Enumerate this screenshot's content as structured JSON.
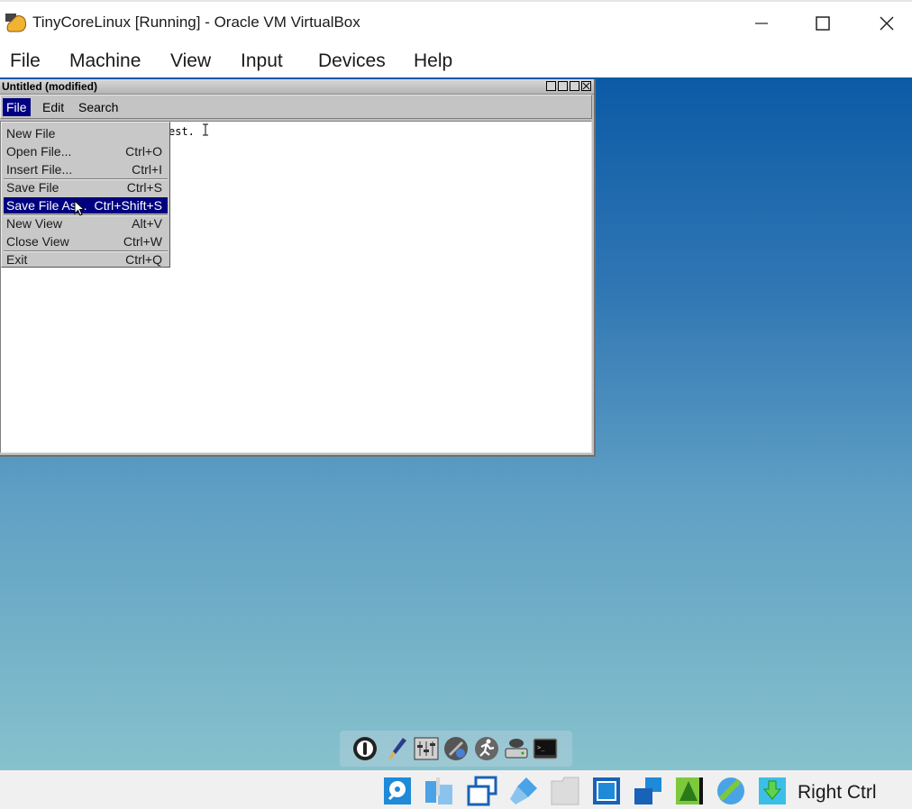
{
  "window": {
    "title": "TinyCoreLinux [Running] - Oracle VM VirtualBox",
    "minimize_glyph": "—",
    "close_glyph": "✕"
  },
  "host_menu": [
    "File",
    "Machine",
    "View",
    "Input",
    "Devices",
    "Help"
  ],
  "editor": {
    "title": "Untitled (modified)",
    "menus": [
      {
        "label": "File",
        "active": true
      },
      {
        "label": "Edit",
        "active": false
      },
      {
        "label": "Search",
        "active": false
      }
    ],
    "visible_text": "est.",
    "file_menu": [
      {
        "label": "New File",
        "shortcut": ""
      },
      {
        "label": "Open File...",
        "shortcut": "Ctrl+O"
      },
      {
        "label": "Insert File...",
        "shortcut": "Ctrl+I"
      },
      {
        "label": "Save File",
        "shortcut": "Ctrl+S"
      },
      {
        "label": "Save File As...",
        "shortcut": "Ctrl+Shift+S",
        "highlighted": true
      },
      {
        "label": "New View",
        "shortcut": "Alt+V"
      },
      {
        "label": "Close View",
        "shortcut": "Ctrl+W"
      },
      {
        "label": "Exit",
        "shortcut": "Ctrl+Q"
      }
    ]
  },
  "dock_icons": [
    "power-icon",
    "paint-brush-icon",
    "control-panel-icon",
    "apps-icon",
    "run-icon",
    "mount-icon",
    "terminal-icon"
  ],
  "status_icons": [
    "hard-disk-icon",
    "optical-drive-icon",
    "shared-windows-icon",
    "usb-icon",
    "shared-folder-icon",
    "display-icon",
    "network-icon",
    "recording-icon",
    "cpu-icon",
    "mouse-integration-icon"
  ],
  "status": {
    "host_key": "Right Ctrl"
  },
  "colors": {
    "menu_highlight": "#000080",
    "desktop_top": "#0c5aa6",
    "desktop_bottom": "#86c2cc"
  }
}
